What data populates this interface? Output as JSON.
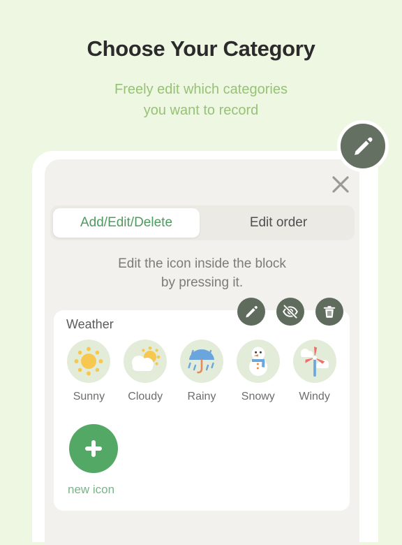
{
  "header": {
    "title": "Choose Your Category",
    "subtitle": "Freely edit which categories\nyou want to record",
    "subtitle_line1": "Freely edit which categories",
    "subtitle_line2": "you want to record"
  },
  "fab": {
    "icon": "pencil-icon",
    "color": "#647062"
  },
  "modal": {
    "close_icon": "close-icon",
    "tabs": [
      {
        "label": "Add/Edit/Delete",
        "active": true
      },
      {
        "label": "Edit order",
        "active": false
      }
    ],
    "instruction_line1": "Edit the icon inside the block",
    "instruction_line2": "by pressing it.",
    "actions": [
      {
        "name": "edit-action",
        "icon": "pencil-icon"
      },
      {
        "name": "hide-action",
        "icon": "eye-off-icon"
      },
      {
        "name": "delete-action",
        "icon": "trash-icon"
      }
    ]
  },
  "weather_card": {
    "title": "Weather",
    "items": [
      {
        "label": "Sunny",
        "icon": "sun-icon"
      },
      {
        "label": "Cloudy",
        "icon": "cloud-sun-icon"
      },
      {
        "label": "Rainy",
        "icon": "umbrella-rain-icon"
      },
      {
        "label": "Snowy",
        "icon": "snowman-icon"
      },
      {
        "label": "Windy",
        "icon": "wind-turbine-icon"
      }
    ],
    "add_label": "new icon",
    "add_icon": "plus-icon"
  },
  "colors": {
    "page_background": "#eef7e2",
    "subtitle_green": "#96c276",
    "accent_green": "#4f9a5f",
    "add_green": "#53a866",
    "dark_button": "#5f6b5d",
    "icon_circle": "#e2ecd8"
  }
}
